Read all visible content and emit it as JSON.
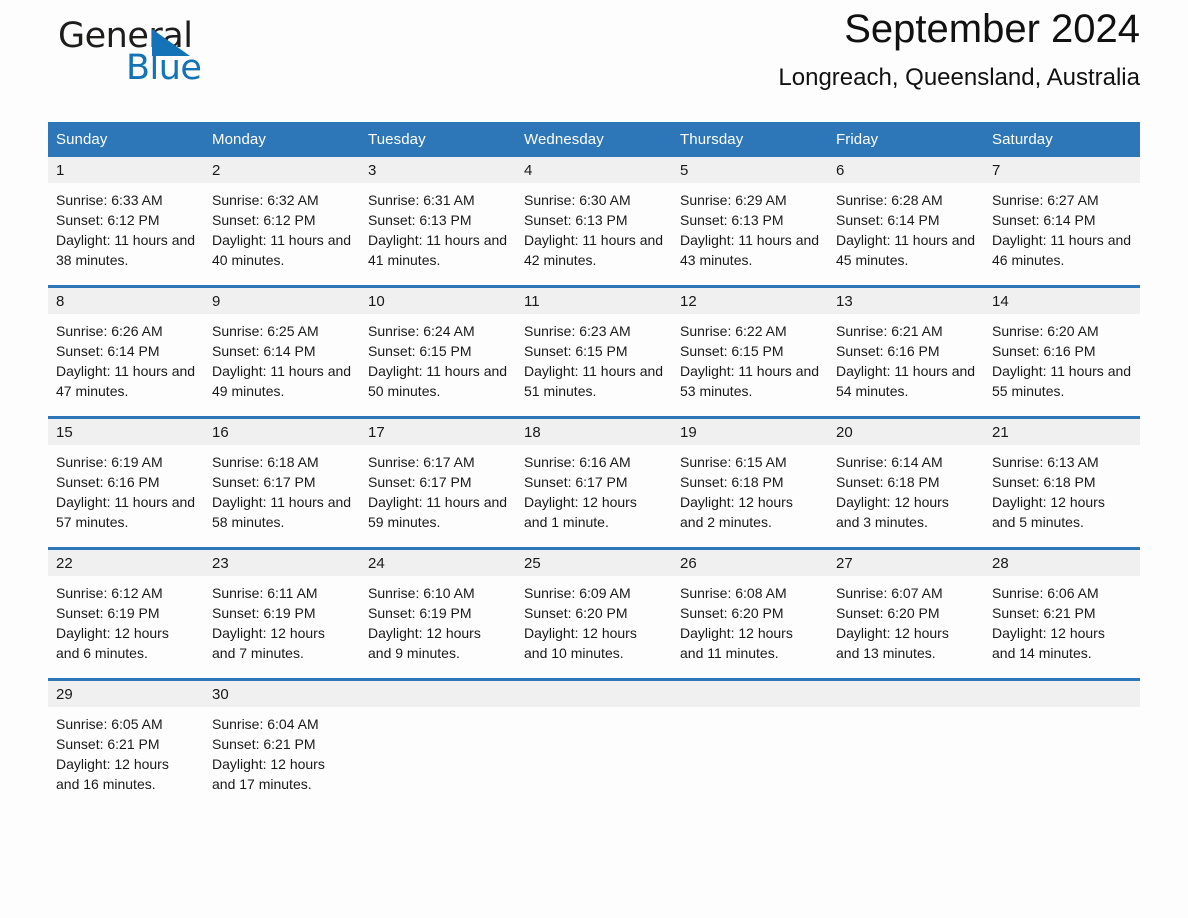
{
  "brand": {
    "name_part1": "General",
    "name_part2": "Blue",
    "triangle_color": "#1473b7"
  },
  "header": {
    "title": "September 2024",
    "subtitle": "Longreach, Queensland, Australia"
  },
  "theme": {
    "accent": "#2d76b8",
    "daynum_band": "#f0f0f0",
    "page_background": "#fdfdfd",
    "header_text": "#ffffff"
  },
  "calendar": {
    "weekday_headers": [
      "Sunday",
      "Monday",
      "Tuesday",
      "Wednesday",
      "Thursday",
      "Friday",
      "Saturday"
    ],
    "weeks": [
      [
        {
          "day": "1",
          "sunrise": "Sunrise: 6:33 AM",
          "sunset": "Sunset: 6:12 PM",
          "daylight": "Daylight: 11 hours and 38 minutes."
        },
        {
          "day": "2",
          "sunrise": "Sunrise: 6:32 AM",
          "sunset": "Sunset: 6:12 PM",
          "daylight": "Daylight: 11 hours and 40 minutes."
        },
        {
          "day": "3",
          "sunrise": "Sunrise: 6:31 AM",
          "sunset": "Sunset: 6:13 PM",
          "daylight": "Daylight: 11 hours and 41 minutes."
        },
        {
          "day": "4",
          "sunrise": "Sunrise: 6:30 AM",
          "sunset": "Sunset: 6:13 PM",
          "daylight": "Daylight: 11 hours and 42 minutes."
        },
        {
          "day": "5",
          "sunrise": "Sunrise: 6:29 AM",
          "sunset": "Sunset: 6:13 PM",
          "daylight": "Daylight: 11 hours and 43 minutes."
        },
        {
          "day": "6",
          "sunrise": "Sunrise: 6:28 AM",
          "sunset": "Sunset: 6:14 PM",
          "daylight": "Daylight: 11 hours and 45 minutes."
        },
        {
          "day": "7",
          "sunrise": "Sunrise: 6:27 AM",
          "sunset": "Sunset: 6:14 PM",
          "daylight": "Daylight: 11 hours and 46 minutes."
        }
      ],
      [
        {
          "day": "8",
          "sunrise": "Sunrise: 6:26 AM",
          "sunset": "Sunset: 6:14 PM",
          "daylight": "Daylight: 11 hours and 47 minutes."
        },
        {
          "day": "9",
          "sunrise": "Sunrise: 6:25 AM",
          "sunset": "Sunset: 6:14 PM",
          "daylight": "Daylight: 11 hours and 49 minutes."
        },
        {
          "day": "10",
          "sunrise": "Sunrise: 6:24 AM",
          "sunset": "Sunset: 6:15 PM",
          "daylight": "Daylight: 11 hours and 50 minutes."
        },
        {
          "day": "11",
          "sunrise": "Sunrise: 6:23 AM",
          "sunset": "Sunset: 6:15 PM",
          "daylight": "Daylight: 11 hours and 51 minutes."
        },
        {
          "day": "12",
          "sunrise": "Sunrise: 6:22 AM",
          "sunset": "Sunset: 6:15 PM",
          "daylight": "Daylight: 11 hours and 53 minutes."
        },
        {
          "day": "13",
          "sunrise": "Sunrise: 6:21 AM",
          "sunset": "Sunset: 6:16 PM",
          "daylight": "Daylight: 11 hours and 54 minutes."
        },
        {
          "day": "14",
          "sunrise": "Sunrise: 6:20 AM",
          "sunset": "Sunset: 6:16 PM",
          "daylight": "Daylight: 11 hours and 55 minutes."
        }
      ],
      [
        {
          "day": "15",
          "sunrise": "Sunrise: 6:19 AM",
          "sunset": "Sunset: 6:16 PM",
          "daylight": "Daylight: 11 hours and 57 minutes."
        },
        {
          "day": "16",
          "sunrise": "Sunrise: 6:18 AM",
          "sunset": "Sunset: 6:17 PM",
          "daylight": "Daylight: 11 hours and 58 minutes."
        },
        {
          "day": "17",
          "sunrise": "Sunrise: 6:17 AM",
          "sunset": "Sunset: 6:17 PM",
          "daylight": "Daylight: 11 hours and 59 minutes."
        },
        {
          "day": "18",
          "sunrise": "Sunrise: 6:16 AM",
          "sunset": "Sunset: 6:17 PM",
          "daylight": "Daylight: 12 hours and 1 minute."
        },
        {
          "day": "19",
          "sunrise": "Sunrise: 6:15 AM",
          "sunset": "Sunset: 6:18 PM",
          "daylight": "Daylight: 12 hours and 2 minutes."
        },
        {
          "day": "20",
          "sunrise": "Sunrise: 6:14 AM",
          "sunset": "Sunset: 6:18 PM",
          "daylight": "Daylight: 12 hours and 3 minutes."
        },
        {
          "day": "21",
          "sunrise": "Sunrise: 6:13 AM",
          "sunset": "Sunset: 6:18 PM",
          "daylight": "Daylight: 12 hours and 5 minutes."
        }
      ],
      [
        {
          "day": "22",
          "sunrise": "Sunrise: 6:12 AM",
          "sunset": "Sunset: 6:19 PM",
          "daylight": "Daylight: 12 hours and 6 minutes."
        },
        {
          "day": "23",
          "sunrise": "Sunrise: 6:11 AM",
          "sunset": "Sunset: 6:19 PM",
          "daylight": "Daylight: 12 hours and 7 minutes."
        },
        {
          "day": "24",
          "sunrise": "Sunrise: 6:10 AM",
          "sunset": "Sunset: 6:19 PM",
          "daylight": "Daylight: 12 hours and 9 minutes."
        },
        {
          "day": "25",
          "sunrise": "Sunrise: 6:09 AM",
          "sunset": "Sunset: 6:20 PM",
          "daylight": "Daylight: 12 hours and 10 minutes."
        },
        {
          "day": "26",
          "sunrise": "Sunrise: 6:08 AM",
          "sunset": "Sunset: 6:20 PM",
          "daylight": "Daylight: 12 hours and 11 minutes."
        },
        {
          "day": "27",
          "sunrise": "Sunrise: 6:07 AM",
          "sunset": "Sunset: 6:20 PM",
          "daylight": "Daylight: 12 hours and 13 minutes."
        },
        {
          "day": "28",
          "sunrise": "Sunrise: 6:06 AM",
          "sunset": "Sunset: 6:21 PM",
          "daylight": "Daylight: 12 hours and 14 minutes."
        }
      ],
      [
        {
          "day": "29",
          "sunrise": "Sunrise: 6:05 AM",
          "sunset": "Sunset: 6:21 PM",
          "daylight": "Daylight: 12 hours and 16 minutes."
        },
        {
          "day": "30",
          "sunrise": "Sunrise: 6:04 AM",
          "sunset": "Sunset: 6:21 PM",
          "daylight": "Daylight: 12 hours and 17 minutes."
        },
        {
          "day": "",
          "sunrise": "",
          "sunset": "",
          "daylight": ""
        },
        {
          "day": "",
          "sunrise": "",
          "sunset": "",
          "daylight": ""
        },
        {
          "day": "",
          "sunrise": "",
          "sunset": "",
          "daylight": ""
        },
        {
          "day": "",
          "sunrise": "",
          "sunset": "",
          "daylight": ""
        },
        {
          "day": "",
          "sunrise": "",
          "sunset": "",
          "daylight": ""
        }
      ]
    ]
  }
}
